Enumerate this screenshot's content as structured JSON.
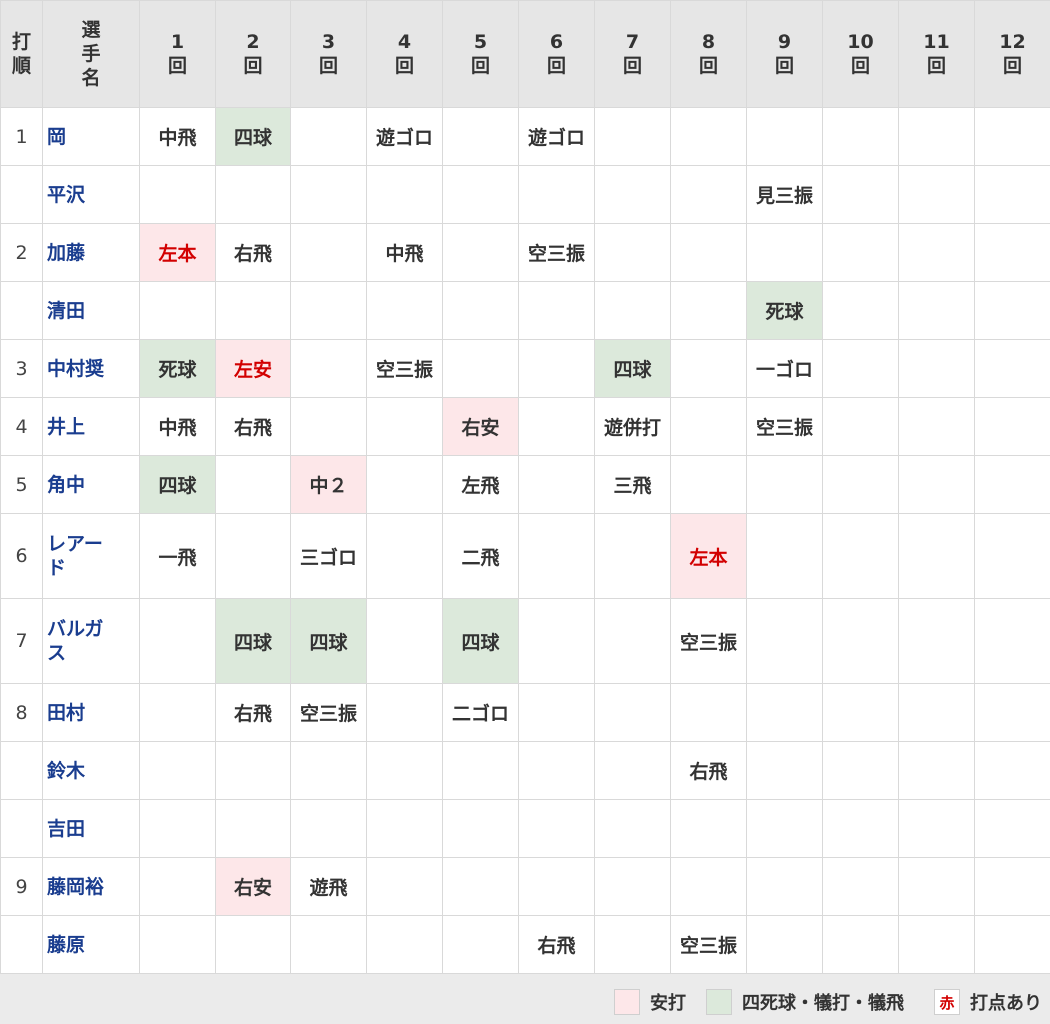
{
  "header": {
    "order": "打順",
    "player": "選手名",
    "innings": [
      "1回",
      "2回",
      "3回",
      "4回",
      "5回",
      "6回",
      "7回",
      "8回",
      "9回",
      "10回",
      "11回",
      "12回"
    ]
  },
  "rows": [
    {
      "order": "1",
      "name": "岡",
      "cells": [
        "中飛",
        "四球",
        "",
        "遊ゴロ",
        "",
        "遊ゴロ",
        "",
        "",
        "",
        "",
        "",
        ""
      ],
      "types": [
        "",
        "walk",
        "",
        "",
        "",
        "",
        "",
        "",
        "",
        "",
        "",
        ""
      ],
      "rbi": []
    },
    {
      "order": "",
      "name": "平沢",
      "cells": [
        "",
        "",
        "",
        "",
        "",
        "",
        "",
        "",
        "見三振",
        "",
        "",
        ""
      ],
      "types": [
        "",
        "",
        "",
        "",
        "",
        "",
        "",
        "",
        "",
        "",
        "",
        ""
      ],
      "rbi": []
    },
    {
      "order": "2",
      "name": "加藤",
      "cells": [
        "左本",
        "右飛",
        "",
        "中飛",
        "",
        "空三振",
        "",
        "",
        "",
        "",
        "",
        ""
      ],
      "types": [
        "hit",
        "",
        "",
        "",
        "",
        "",
        "",
        "",
        "",
        "",
        "",
        ""
      ],
      "rbi": [
        0
      ]
    },
    {
      "order": "",
      "name": "清田",
      "cells": [
        "",
        "",
        "",
        "",
        "",
        "",
        "",
        "",
        "死球",
        "",
        "",
        ""
      ],
      "types": [
        "",
        "",
        "",
        "",
        "",
        "",
        "",
        "",
        "walk",
        "",
        "",
        ""
      ],
      "rbi": []
    },
    {
      "order": "3",
      "name": "中村奨",
      "cells": [
        "死球",
        "左安",
        "",
        "空三振",
        "",
        "",
        "四球",
        "",
        "一ゴロ",
        "",
        "",
        ""
      ],
      "types": [
        "walk",
        "hit",
        "",
        "",
        "",
        "",
        "walk",
        "",
        "",
        "",
        "",
        ""
      ],
      "rbi": [
        1
      ]
    },
    {
      "order": "4",
      "name": "井上",
      "cells": [
        "中飛",
        "右飛",
        "",
        "",
        "右安",
        "",
        "遊併打",
        "",
        "空三振",
        "",
        "",
        ""
      ],
      "types": [
        "",
        "",
        "",
        "",
        "hit",
        "",
        "",
        "",
        "",
        "",
        "",
        ""
      ],
      "rbi": []
    },
    {
      "order": "5",
      "name": "角中",
      "cells": [
        "四球",
        "",
        "中２",
        "",
        "左飛",
        "",
        "三飛",
        "",
        "",
        "",
        "",
        ""
      ],
      "types": [
        "walk",
        "",
        "hit",
        "",
        "",
        "",
        "",
        "",
        "",
        "",
        "",
        ""
      ],
      "rbi": []
    },
    {
      "order": "6",
      "name": "レアード",
      "cells": [
        "一飛",
        "",
        "三ゴロ",
        "",
        "二飛",
        "",
        "",
        "左本",
        "",
        "",
        "",
        ""
      ],
      "types": [
        "",
        "",
        "",
        "",
        "",
        "",
        "",
        "hit",
        "",
        "",
        "",
        ""
      ],
      "rbi": [
        7
      ],
      "tall": true
    },
    {
      "order": "7",
      "name": "バルガス",
      "cells": [
        "",
        "四球",
        "四球",
        "",
        "四球",
        "",
        "",
        "空三振",
        "",
        "",
        "",
        ""
      ],
      "types": [
        "",
        "walk",
        "walk",
        "",
        "walk",
        "",
        "",
        "",
        "",
        "",
        "",
        ""
      ],
      "rbi": [],
      "tall": true
    },
    {
      "order": "8",
      "name": "田村",
      "cells": [
        "",
        "右飛",
        "空三振",
        "",
        "二ゴロ",
        "",
        "",
        "",
        "",
        "",
        "",
        ""
      ],
      "types": [
        "",
        "",
        "",
        "",
        "",
        "",
        "",
        "",
        "",
        "",
        "",
        ""
      ],
      "rbi": []
    },
    {
      "order": "",
      "name": "鈴木",
      "cells": [
        "",
        "",
        "",
        "",
        "",
        "",
        "",
        "右飛",
        "",
        "",
        "",
        ""
      ],
      "types": [
        "",
        "",
        "",
        "",
        "",
        "",
        "",
        "",
        "",
        "",
        "",
        ""
      ],
      "rbi": []
    },
    {
      "order": "",
      "name": "吉田",
      "cells": [
        "",
        "",
        "",
        "",
        "",
        "",
        "",
        "",
        "",
        "",
        "",
        ""
      ],
      "types": [
        "",
        "",
        "",
        "",
        "",
        "",
        "",
        "",
        "",
        "",
        "",
        ""
      ],
      "rbi": []
    },
    {
      "order": "9",
      "name": "藤岡裕",
      "cells": [
        "",
        "右安",
        "遊飛",
        "",
        "",
        "",
        "",
        "",
        "",
        "",
        "",
        ""
      ],
      "types": [
        "",
        "hit",
        "",
        "",
        "",
        "",
        "",
        "",
        "",
        "",
        "",
        ""
      ],
      "rbi": []
    },
    {
      "order": "",
      "name": "藤原",
      "cells": [
        "",
        "",
        "",
        "",
        "",
        "右飛",
        "",
        "空三振",
        "",
        "",
        "",
        ""
      ],
      "types": [
        "",
        "",
        "",
        "",
        "",
        "",
        "",
        "",
        "",
        "",
        "",
        ""
      ],
      "rbi": []
    }
  ],
  "legend": {
    "hit_label": "安打",
    "walk_label": "四死球・犠打・犠飛",
    "rbi_mark": "赤",
    "rbi_label": "打点あり"
  },
  "colors": {
    "hit_bg": "#fde7e9",
    "walk_bg": "#dce9db",
    "rbi_text": "#d20000",
    "name_text": "#1a3d8f",
    "header_bg": "#e6e6e6"
  }
}
